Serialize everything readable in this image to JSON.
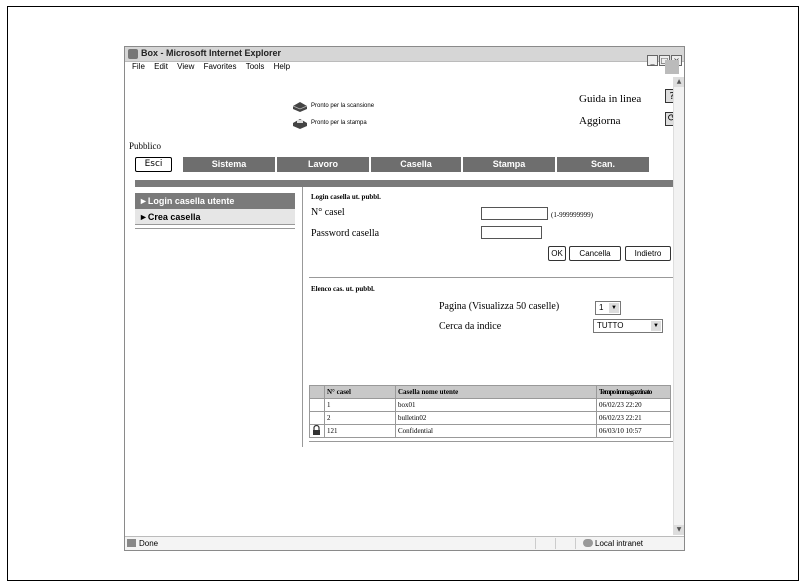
{
  "window": {
    "title": "Box - Microsoft Internet Explorer",
    "menus": [
      "File",
      "Edit",
      "View",
      "Favorites",
      "Tools",
      "Help"
    ]
  },
  "status": {
    "scan": "Pronto per la scansione",
    "print": "Pronto per la stampa"
  },
  "header": {
    "guida": "Guida in linea",
    "aggiorna": "Aggiorna",
    "help_icon": "?",
    "refresh_icon": "⟳"
  },
  "mode_label": "Pubblico",
  "esci": "Esci",
  "tabs": [
    "Sistema",
    "Lavoro",
    "Casella",
    "Stampa",
    "Scan."
  ],
  "sidebar": {
    "items": [
      {
        "label": "►Login casella utente",
        "active": true
      },
      {
        "label": "►Crea casella",
        "active": false
      }
    ]
  },
  "login": {
    "title": "Login casella ut. pubbl.",
    "box_no_label": "N° casel",
    "box_no_value": "",
    "range_hint": "(1-999999999)",
    "password_label": "Password casella",
    "password_value": "",
    "ok": "OK",
    "cancel": "Cancella",
    "back": "Indietro"
  },
  "list": {
    "title": "Elenco cas. ut. pubbl.",
    "page_label": "Pagina (Visualizza 50 caselle)",
    "page_value": "1",
    "index_label": "Cerca da indice",
    "index_value": "TUTTO",
    "columns": [
      "N° casel",
      "Casella nome utente",
      "Tempo immagazzinato"
    ],
    "rows": [
      {
        "lock": false,
        "no": "1",
        "name": "box01",
        "time": "06/02/23 22:20"
      },
      {
        "lock": false,
        "no": "2",
        "name": "bulletin02",
        "time": "06/02/23 22:21"
      },
      {
        "lock": true,
        "no": "121",
        "name": "Confidential",
        "time": "06/03/10 10:57"
      }
    ]
  },
  "statusbar": {
    "left": "Done",
    "zone": "Local intranet"
  }
}
